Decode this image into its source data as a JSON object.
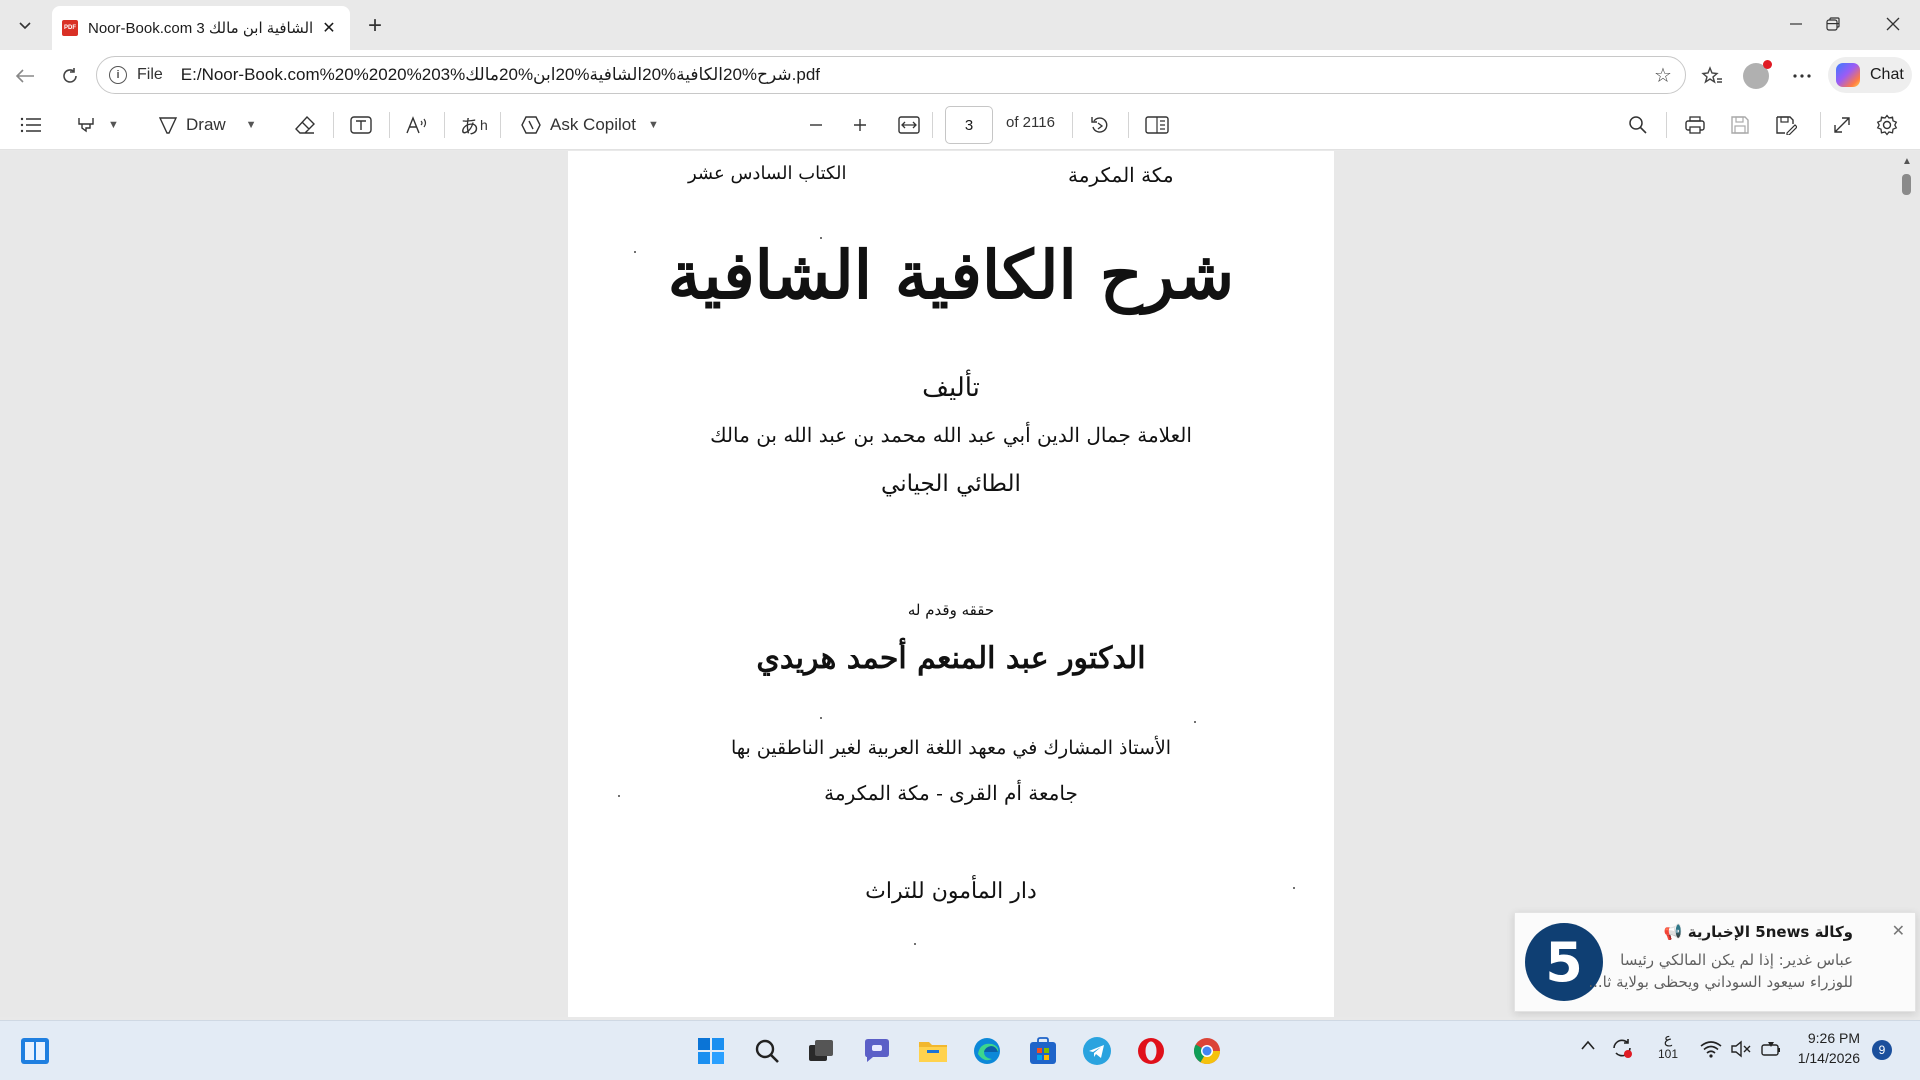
{
  "tab": {
    "title": "Noor-Book.com الشافية ابن مالك 3",
    "favicon_text": "PDF",
    "close_glyph": "✕"
  },
  "new_tab_glyph": "+",
  "address": {
    "scheme_label": "File",
    "url": "E:/Noor-Book.com%20%2020%203%شرح%20الكافية%20الشافية%20ابن%20مالك.pdf"
  },
  "copilot": {
    "label": "Chat"
  },
  "toolbar": {
    "draw_label": "Draw",
    "ask_copilot_label": "Ask Copilot",
    "page_number": "3",
    "page_count": "of 2116"
  },
  "document": {
    "header_left": "الكتاب السادس عشر",
    "header_right": "مكة المكرمة",
    "title": "شرح الكافية الشافية",
    "authorship_label": "تأليف",
    "author_line1": "العلامة جمال الدين أبي عبد الله محمد بن عبد الله بن مالك",
    "author_line2": "الطائي الجياني",
    "editor_label": "حققه وقدم له",
    "editor_name": "الدكتور عبد المنعم أحمد هريدي",
    "editor_title": "الأستاذ المشارك في معهد اللغة العربية لغير الناطقين بها",
    "editor_university": "جامعة أم القرى - مكة المكرمة",
    "publisher": "دار المأمون للتراث"
  },
  "notification": {
    "source": "وكالة 5news الإخبارية 📢",
    "line1": "عباس غدير: إذا لم يكن المالكي رئيسا",
    "line2": "للوزراء سيعود السوداني ويحظى بولاية ثا...",
    "logo_text": "5"
  },
  "tray": {
    "lang_label": "ع",
    "lang_code": "101",
    "time": "9:26 PM",
    "date": "1/14/2026",
    "badge": "9"
  },
  "colors": {
    "accent": "#0f6cbd",
    "pdf_red": "#d93025",
    "opera_red": "#e0101a"
  }
}
